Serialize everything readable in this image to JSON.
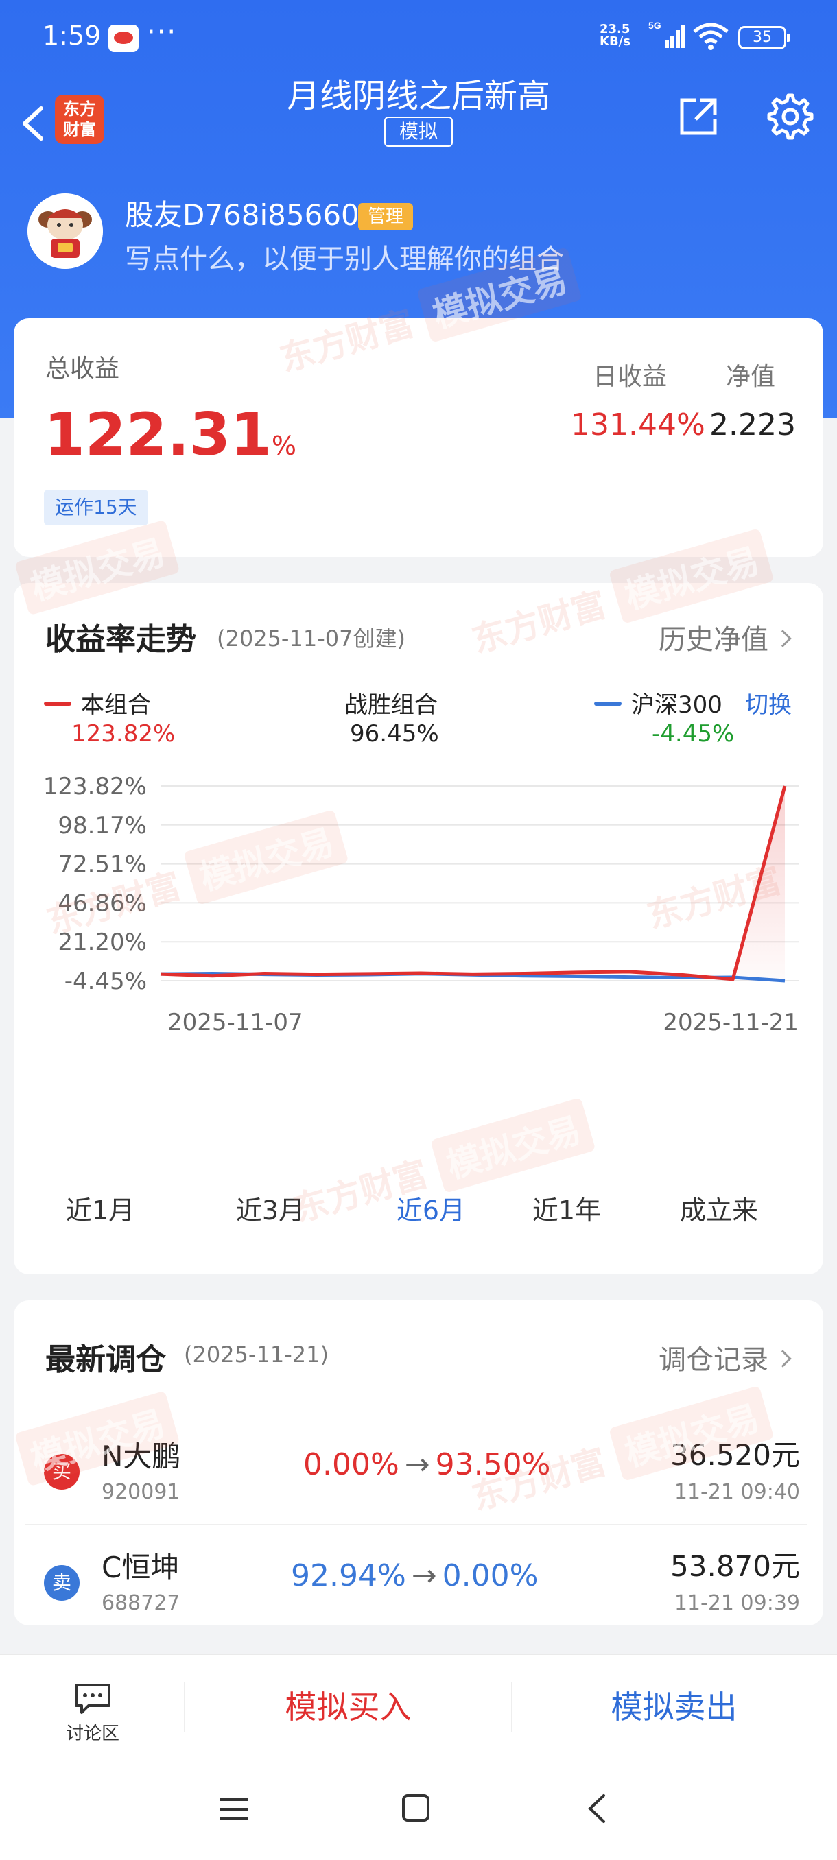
{
  "status_bar": {
    "time": "1:59",
    "more": "···",
    "net_speed": "23.5",
    "net_unit": "KB/s",
    "battery": "35"
  },
  "header": {
    "title": "月线阴线之后新高",
    "subtitle": "模拟",
    "logo_line1": "东方",
    "logo_line2": "财富"
  },
  "profile": {
    "name": "股友D768i85660",
    "badge": "管理",
    "description": "写点什么，以便于别人理解你的组合"
  },
  "summary": {
    "total_label": "总收益",
    "total_value": "122.31",
    "total_unit": "%",
    "run_days": "运作15天",
    "daily_label": "日收益",
    "daily_value": "131.44%",
    "nav_label": "净值",
    "nav_value": "2.223"
  },
  "chart_section": {
    "title": "收益率走势",
    "created": "(2025-11-07创建)",
    "history_link": "历史净值",
    "switch": "切换",
    "legend": [
      {
        "name": "本组合",
        "value": "123.82%"
      },
      {
        "name": "战胜组合",
        "value": "96.45%"
      },
      {
        "name": "沪深300",
        "value": "-4.45%"
      }
    ],
    "ranges": [
      "近1月",
      "近3月",
      "近6月",
      "近1年",
      "成立来"
    ],
    "active_range": "近6月"
  },
  "chart_data": {
    "type": "line",
    "y_ticks": [
      "123.82%",
      "98.17%",
      "72.51%",
      "46.86%",
      "21.20%",
      "-4.45%"
    ],
    "ylim": [
      -4.45,
      123.82
    ],
    "x_labels": [
      "2025-11-07",
      "2025-11-21"
    ],
    "x": [
      "2025-11-07",
      "2025-11-08",
      "2025-11-09",
      "2025-11-10",
      "2025-11-11",
      "2025-11-12",
      "2025-11-13",
      "2025-11-14",
      "2025-11-17",
      "2025-11-18",
      "2025-11-19",
      "2025-11-20",
      "2025-11-21"
    ],
    "series": [
      {
        "name": "本组合",
        "color": "#e02f2f",
        "values": [
          0,
          -1.2,
          0.3,
          -0.2,
          0.1,
          0.5,
          -0.1,
          0.3,
          1.0,
          1.5,
          -0.5,
          -3.5,
          123.82
        ]
      },
      {
        "name": "沪深300",
        "color": "#3a78d8",
        "values": [
          0,
          0.3,
          -0.2,
          -0.6,
          -0.4,
          0.2,
          -0.5,
          -1.2,
          -1.5,
          -2.0,
          -2.4,
          -2.2,
          -4.45
        ]
      }
    ]
  },
  "trades": {
    "title": "最新调仓",
    "date": "(2025-11-21)",
    "link": "调仓记录",
    "rows": [
      {
        "side": "买",
        "name": "N大鹏",
        "code": "920091",
        "from": "0.00%",
        "to": "93.50%",
        "price": "36.520元",
        "time": "11-21  09:40"
      },
      {
        "side": "卖",
        "name": "C恒坤",
        "code": "688727",
        "from": "92.94%",
        "to": "0.00%",
        "price": "53.870元",
        "time": "11-21  09:39"
      }
    ]
  },
  "bottom_bar": {
    "discuss": "讨论区",
    "buy": "模拟买入",
    "sell": "模拟卖出"
  },
  "watermark": {
    "brand": "东方财富",
    "mode": "模拟交易"
  }
}
